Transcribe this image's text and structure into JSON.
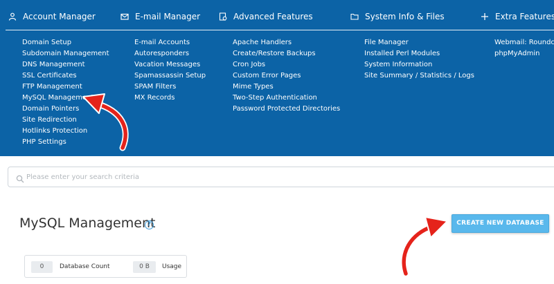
{
  "nav": {
    "categories": [
      {
        "label": "Account Manager",
        "icon": "user-icon"
      },
      {
        "label": "E-mail Manager",
        "icon": "envelope-icon"
      },
      {
        "label": "Advanced Features",
        "icon": "gear-doc-icon"
      },
      {
        "label": "System Info & Files",
        "icon": "folder-icon"
      },
      {
        "label": "Extra Features",
        "icon": "plus-icon"
      }
    ],
    "columns": [
      [
        "Domain Setup",
        "Subdomain Management",
        "DNS Management",
        "SSL Certificates",
        "FTP Management",
        "MySQL Management",
        "Domain Pointers",
        "Site Redirection",
        "Hotlinks Protection",
        "PHP Settings"
      ],
      [
        "E-mail Accounts",
        "Autoresponders",
        "Vacation Messages",
        "Spamassassin Setup",
        "SPAM Filters",
        "MX Records"
      ],
      [
        "Apache Handlers",
        "Create/Restore Backups",
        "Cron Jobs",
        "Custom Error Pages",
        "Mime Types",
        "Two-Step Authentication",
        "Password Protected Directories"
      ],
      [
        "File Manager",
        "Installed Perl Modules",
        "System Information",
        "Site Summary / Statistics / Logs"
      ],
      [
        "Webmail: Roundcube",
        "phpMyAdmin"
      ]
    ]
  },
  "search": {
    "placeholder": "Please enter your search criteria",
    "value": ""
  },
  "page": {
    "title": "MySQL Management",
    "help": "?"
  },
  "actions": {
    "create_label": "CREATE NEW DATABASE"
  },
  "stats": {
    "db_count_value": "0",
    "db_count_label": "Database Count",
    "usage_value": "0 B",
    "usage_label": "Usage"
  },
  "colors": {
    "nav_bg": "#0c63a6",
    "button": "#59b8ec",
    "arrow": "#e5231b"
  }
}
